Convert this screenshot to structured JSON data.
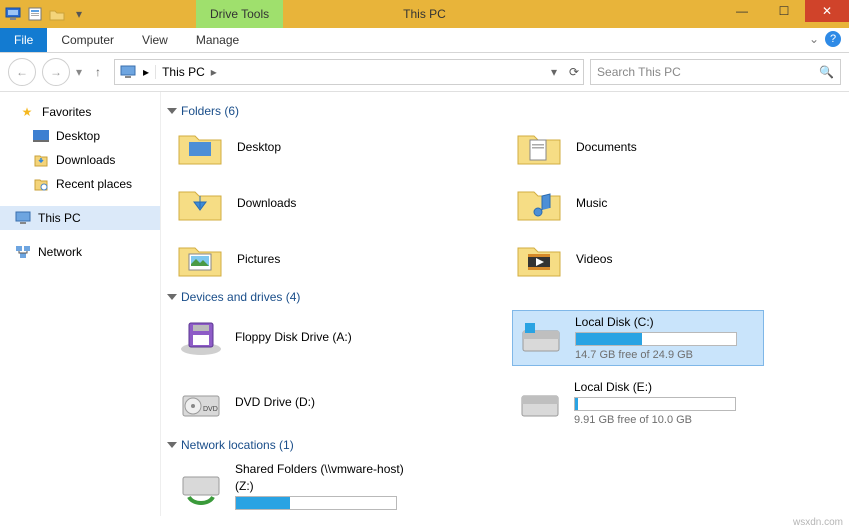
{
  "title": "This PC",
  "drive_tools_label": "Drive Tools",
  "tabs": {
    "file": "File",
    "computer": "Computer",
    "view": "View",
    "manage": "Manage"
  },
  "address": {
    "location": "This PC"
  },
  "search": {
    "placeholder": "Search This PC"
  },
  "nav": {
    "favorites": {
      "label": "Favorites",
      "desktop": "Desktop",
      "downloads": "Downloads",
      "recent": "Recent places"
    },
    "thispc": "This PC",
    "network": "Network"
  },
  "sections": {
    "folders": {
      "header": "Folders (6)",
      "items": [
        "Desktop",
        "Documents",
        "Downloads",
        "Music",
        "Pictures",
        "Videos"
      ]
    },
    "drives": {
      "header": "Devices and drives (4)",
      "floppy": {
        "name": "Floppy Disk Drive (A:)"
      },
      "c": {
        "name": "Local Disk (C:)",
        "sub": "14.7 GB free of 24.9 GB",
        "fill_pct": 41
      },
      "dvd": {
        "name": "DVD Drive (D:)"
      },
      "e": {
        "name": "Local Disk (E:)",
        "sub": "9.91 GB free of 10.0 GB",
        "fill_pct": 2
      }
    },
    "network": {
      "header": "Network locations (1)",
      "share": {
        "name": "Shared Folders (\\\\vmware-host)",
        "z": "(Z:)",
        "fill_pct": 34
      }
    }
  },
  "footer": "wsxdn.com"
}
